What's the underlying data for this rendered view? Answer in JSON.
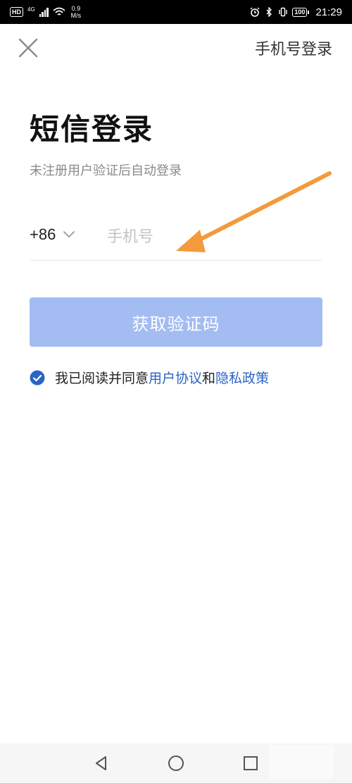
{
  "status_bar": {
    "hd": "HD",
    "network": "4G",
    "speed_value": "0.9",
    "speed_unit": "M/s",
    "battery": "100",
    "time": "21:29",
    "icons": [
      "alarm-icon",
      "bluetooth-icon",
      "vibrate-icon",
      "battery-icon",
      "wifi-icon",
      "signal-icon"
    ]
  },
  "header": {
    "close_icon": "close-icon",
    "phone_login": "手机号登录"
  },
  "main": {
    "title": "短信登录",
    "subtitle": "未注册用户验证后自动登录",
    "country_code": "+86",
    "phone_placeholder": "手机号",
    "phone_value": "",
    "get_code_label": "获取验证码",
    "agreement_prefix": "我已阅读并同意",
    "user_agreement": "用户协议",
    "agreement_and": "和",
    "privacy_policy": "隐私政策",
    "agreement_checked": true
  },
  "colors": {
    "button_bg": "#a3bcf2",
    "link": "#2a64c5",
    "checkbox": "#2a64c5",
    "arrow": "#f39a3c"
  },
  "nav": {
    "icons": [
      "back-icon",
      "home-icon",
      "recent-apps-icon"
    ]
  }
}
